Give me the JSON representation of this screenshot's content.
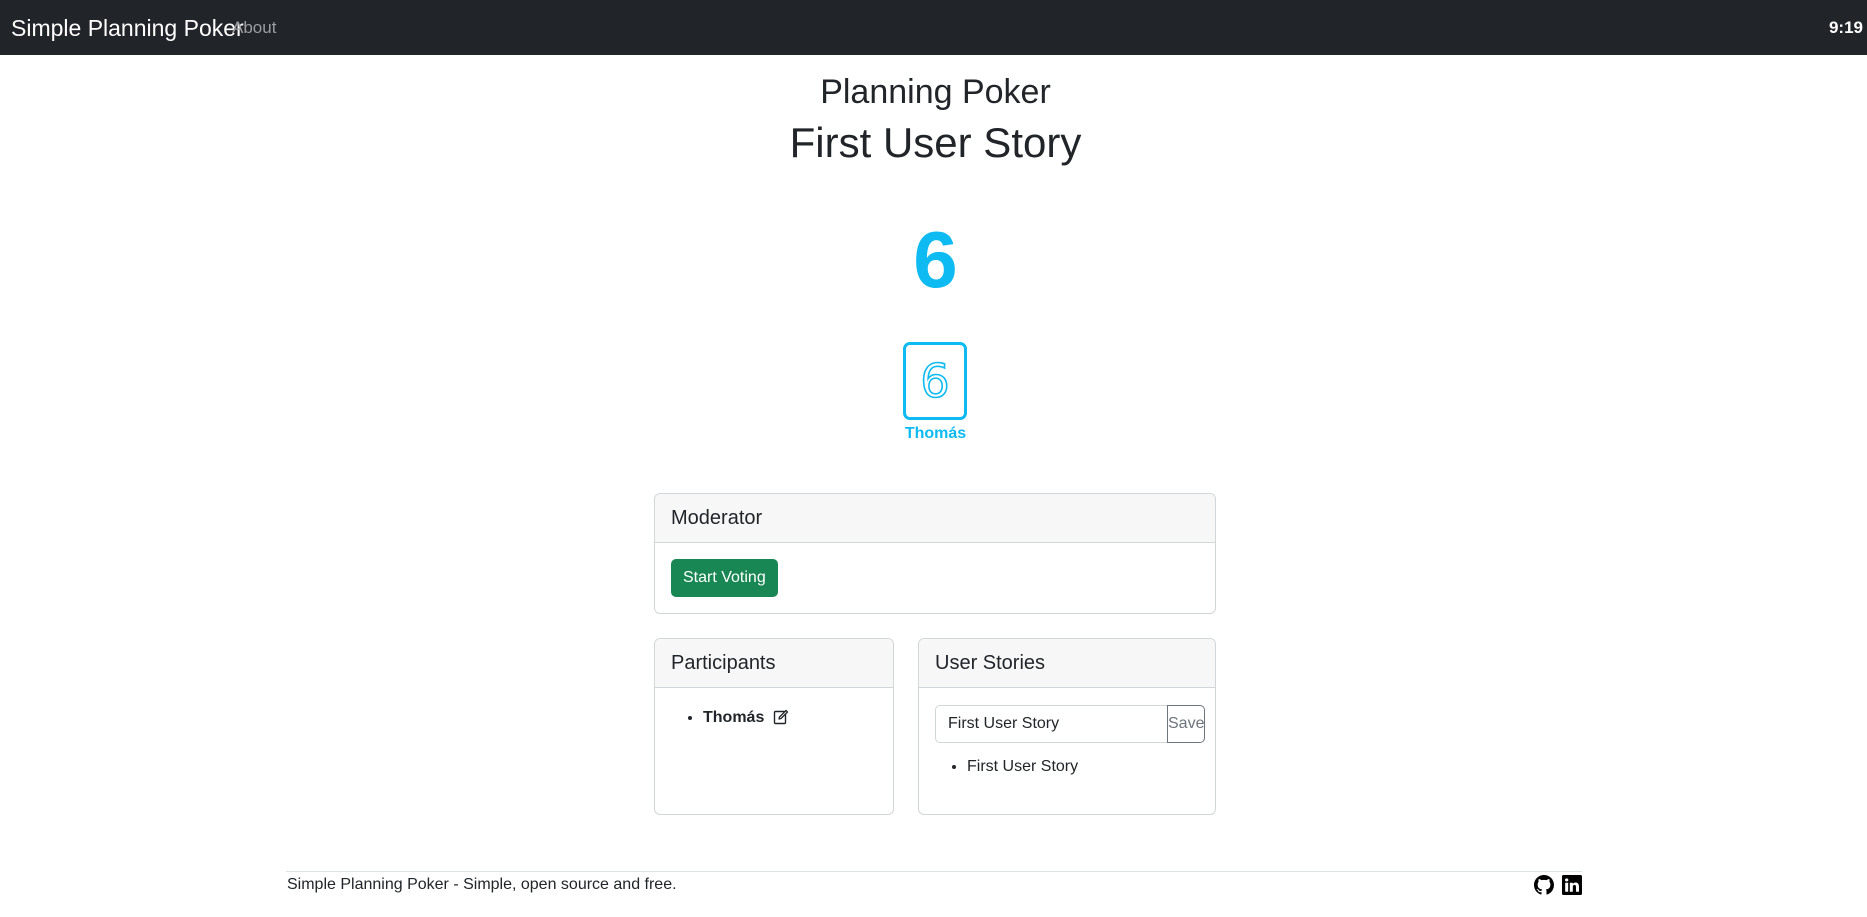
{
  "navbar": {
    "brand": "Simple Planning Poker",
    "about_label": "About",
    "clock": "9:19"
  },
  "header": {
    "title": "Planning Poker",
    "story_title": "First User Story"
  },
  "result": {
    "value": "6"
  },
  "votes": [
    {
      "card": "6",
      "name": "Thomás"
    }
  ],
  "moderator": {
    "title": "Moderator",
    "start_voting_label": "Start Voting"
  },
  "participants": {
    "title": "Participants",
    "items": [
      {
        "name": "Thomás"
      }
    ]
  },
  "user_stories": {
    "title": "User Stories",
    "input_value": "First User Story",
    "save_label": "Save",
    "items": [
      {
        "label": "First User Story"
      }
    ]
  },
  "footer": {
    "text": "Simple Planning Poker - Simple, open source and free.",
    "icons": [
      "github-icon",
      "linkedin-icon"
    ]
  },
  "colors": {
    "navbar_bg": "#212529",
    "accent": "#0dbaf2",
    "success": "#198754"
  }
}
